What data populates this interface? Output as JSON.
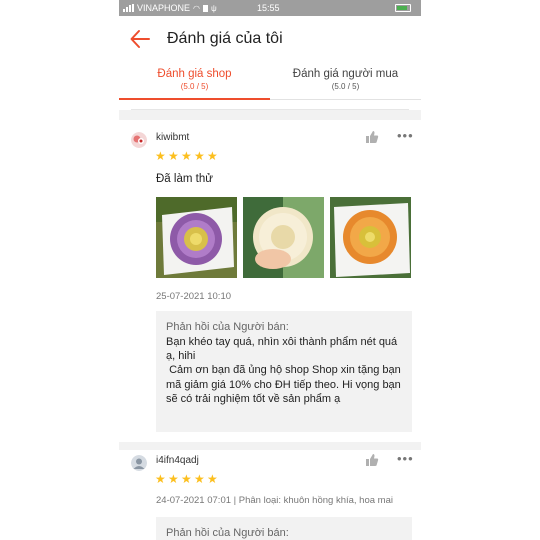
{
  "status_bar": {
    "carrier": "VINAPHONE",
    "time": "15:55",
    "battery_color": "#4caf50"
  },
  "header": {
    "title": "Đánh giá của tôi",
    "back_icon": "arrow-left-icon",
    "accent": "#ee4d2d"
  },
  "tabs": [
    {
      "label": "Đánh giá shop",
      "score": "(5.0 / 5)",
      "active": true
    },
    {
      "label": "Đánh giá người mua",
      "score": "(5.0 / 5)",
      "active": false
    }
  ],
  "reviews": [
    {
      "username": "kiwibmt",
      "stars": 5,
      "text": "Đã làm thử",
      "photos": [
        "purple-mooncake-photo",
        "white-flower-mooncake-photo",
        "orange-mooncake-photo"
      ],
      "date": "25-07-2021 10:10",
      "reply_header": "Phản hồi của Người bán:",
      "reply_body": "Bạn khéo tay quá, nhìn xôi thành phẩm nét quá ạ, hihi\n Cảm ơn bạn đã ủng hộ shop Shop xin tặng bạn mã giảm giá 10% cho ĐH tiếp theo. Hi vọng bạn sẽ có trải nghiệm tốt về sản phẩm ạ"
    },
    {
      "username": "i4ifn4qadj",
      "stars": 5,
      "date_and_category": "24-07-2021 07:01 | Phân loại: khuôn hồng khía, hoa mai",
      "reply_header": "Phản hồi của Người bán:"
    }
  ]
}
